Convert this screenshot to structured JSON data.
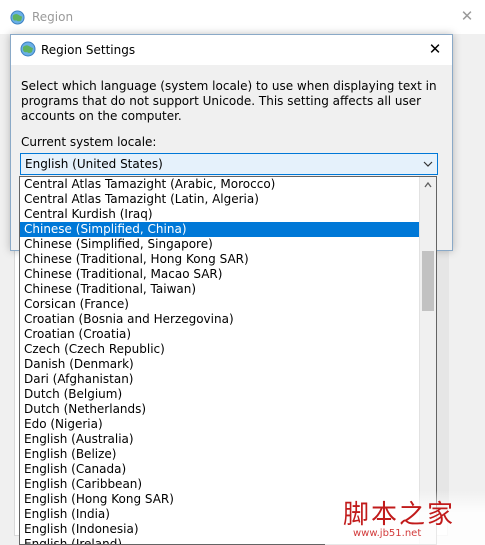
{
  "outer_window": {
    "title": "Region"
  },
  "dialog": {
    "title": "Region Settings",
    "description": "Select which language (system locale) to use when displaying text in programs that do not support Unicode. This setting affects all user accounts on the computer.",
    "locale_label": "Current system locale:",
    "selected_locale": "English (United States)"
  },
  "locale_list": [
    "Central Atlas Tamazight (Arabic, Morocco)",
    "Central Atlas Tamazight (Latin, Algeria)",
    "Central Kurdish (Iraq)",
    "Chinese (Simplified, China)",
    "Chinese (Simplified, Singapore)",
    "Chinese (Traditional, Hong Kong SAR)",
    "Chinese (Traditional, Macao SAR)",
    "Chinese (Traditional, Taiwan)",
    "Corsican (France)",
    "Croatian (Bosnia and Herzegovina)",
    "Croatian (Croatia)",
    "Czech (Czech Republic)",
    "Danish (Denmark)",
    "Dari (Afghanistan)",
    "Dutch (Belgium)",
    "Dutch (Netherlands)",
    "Edo (Nigeria)",
    "English (Australia)",
    "English (Belize)",
    "English (Canada)",
    "English (Caribbean)",
    "English (Hong Kong SAR)",
    "English (India)",
    "English (Indonesia)",
    "English (Ireland)"
  ],
  "highlighted_item": "Chinese (Simplified, China)",
  "watermark": {
    "title": "脚本之家",
    "url": "www.jb51.net"
  },
  "colors": {
    "selection": "#0078d7",
    "select_bg": "#e5f1fb",
    "watermark": "#c11b1b"
  },
  "icons": {
    "title_icon": "globe-icon",
    "close": "close-icon",
    "dropdown": "chevron-down-icon",
    "scroll": "scroll-up-arrow-icon"
  }
}
